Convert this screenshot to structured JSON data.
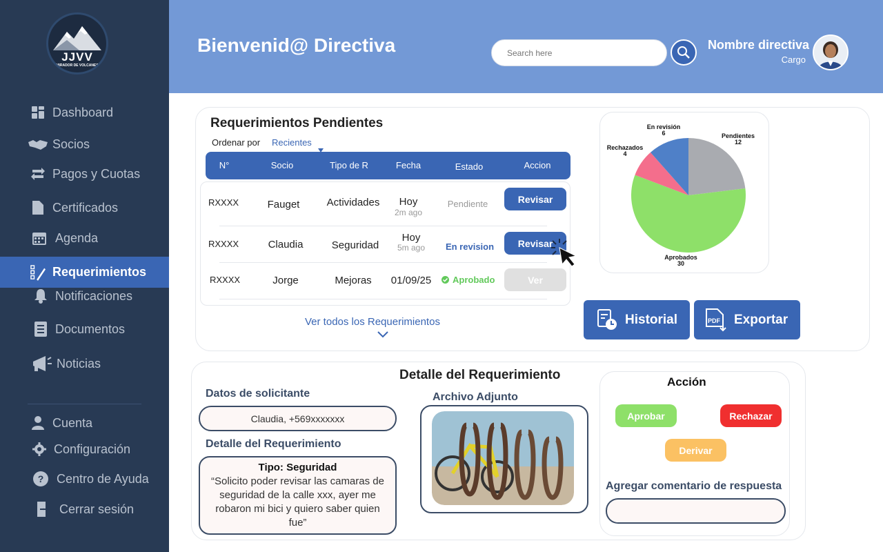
{
  "brand": {
    "logo_text": "JJVV",
    "logo_sub": "MIRADOR DE VOLCANES"
  },
  "sidebar": {
    "items": [
      {
        "label": "Dashboard",
        "icon": "dashboard-icon"
      },
      {
        "label": "Socios",
        "icon": "handshake-icon"
      },
      {
        "label": "Pagos y Cuotas",
        "icon": "transfer-icon"
      },
      {
        "label": "Certificados",
        "icon": "file-icon"
      },
      {
        "label": "Agenda",
        "icon": "calendar-icon"
      },
      {
        "label": "Requerimientos",
        "icon": "checklist-pen-icon",
        "active": true
      },
      {
        "label": "Notificaciones",
        "icon": "bell-icon"
      },
      {
        "label": "Documentos",
        "icon": "document-icon"
      },
      {
        "label": "Noticias",
        "icon": "megaphone-icon"
      }
    ],
    "bottom_items": [
      {
        "label": "Cuenta",
        "icon": "user-icon"
      },
      {
        "label": "Configuración",
        "icon": "gear-icon"
      },
      {
        "label": "Centro de Ayuda",
        "icon": "help-icon"
      },
      {
        "label": "Cerrar sesión",
        "icon": "logout-icon"
      }
    ]
  },
  "header": {
    "welcome": "Bienvenid@ Directiva",
    "search_placeholder": "Search here",
    "user_name": "Nombre directiva",
    "user_role": "Cargo"
  },
  "pending": {
    "title": "Requerimientos Pendientes",
    "sort_label": "Ordenar por",
    "sort_value": "Recientes",
    "columns": [
      "N°",
      "Socio",
      "Tipo de R",
      "Fecha",
      "Estado",
      "Accion"
    ],
    "rows": [
      {
        "id": "RXXXX",
        "socio": "Fauget",
        "tipo": "Actividades",
        "fecha": "Hoy",
        "fecha_sub": "2m ago",
        "estado": "Pendiente",
        "accion": "Revisar"
      },
      {
        "id": "RXXXX",
        "socio": "Claudia",
        "tipo": "Seguridad",
        "fecha": "Hoy",
        "fecha_sub": "5m ago",
        "estado": "En revision",
        "accion": "Revisar"
      },
      {
        "id": "RXXXX",
        "socio": "Jorge",
        "tipo": "Mejoras",
        "fecha": "01/09/25",
        "fecha_sub": "",
        "estado": "Aprobado",
        "accion": "Ver"
      }
    ],
    "see_all": "Ver todos los Requerimientos"
  },
  "chart_data": {
    "type": "pie",
    "slices": [
      {
        "label": "Pendientes",
        "value": 12,
        "color": "#a9abb0"
      },
      {
        "label": "Aprobados",
        "value": 30,
        "color": "#8ee069"
      },
      {
        "label": "Rechazados",
        "value": 4,
        "color": "#f46e8c"
      },
      {
        "label": "En revisión",
        "value": 6,
        "color": "#4f80c8"
      }
    ]
  },
  "actions": {
    "historial": "Historial",
    "exportar": "Exportar",
    "pdf": "PDF"
  },
  "detail": {
    "title": "Detalle del Requerimiento",
    "solicitante_label": "Datos de solicitante",
    "solicitante_value": "Claudia, +569xxxxxxx",
    "detalle_label": "Detalle del Requerimiento",
    "tipo": "Tipo: Seguridad",
    "texto": "“Solicito poder revisar las camaras de seguridad de la calle xxx, ayer me robaron mi bici y quiero saber quien fue”",
    "adjunto_label": "Archivo Adjunto"
  },
  "accion": {
    "title": "Acción",
    "aprobar": "Aprobar",
    "rechazar": "Rechazar",
    "derivar": "Derivar",
    "comentario_label": "Agregar comentario de respuesta"
  },
  "colors": {
    "sidebar": "#283a54",
    "header": "#7399d6",
    "accent": "#3a66b4",
    "approve": "#8ee069",
    "reject": "#f02f2f",
    "derive": "#fbc163"
  }
}
